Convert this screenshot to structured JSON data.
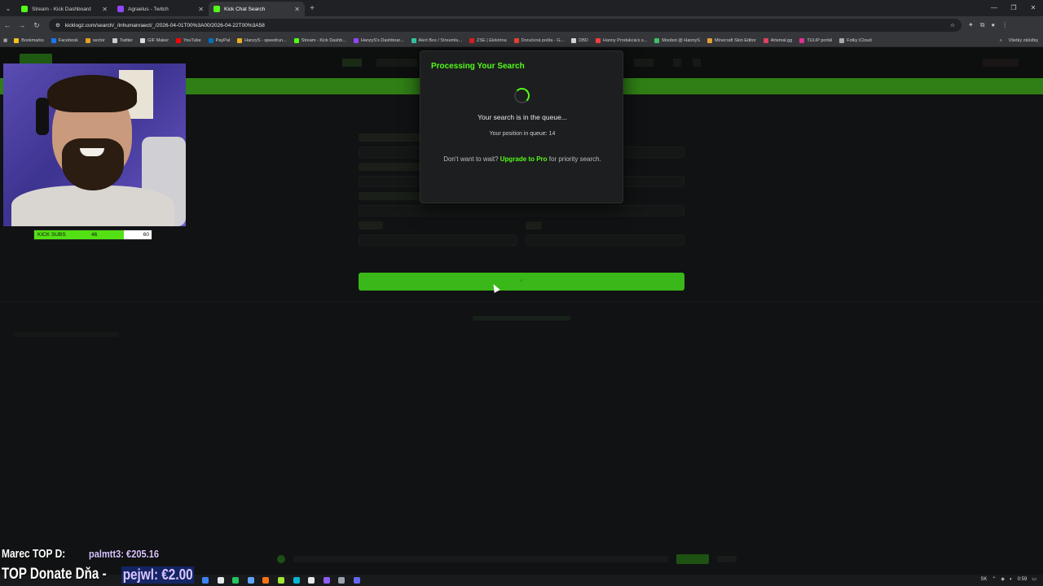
{
  "browser": {
    "tabs": [
      {
        "label": "Stream - Kick Dashboard",
        "color": "#53fc18",
        "active": false
      },
      {
        "label": "Agraelus - Twitch",
        "color": "#9146ff",
        "active": false
      },
      {
        "label": "Kick Chat Search",
        "color": "#53fc18",
        "active": true
      }
    ],
    "url": "kicklogz.com/search/_/inhumanraect/_/2026-04-01T00%3A00/2026-04-22T00%3A58",
    "bookmarks": [
      {
        "label": "Bookmarks",
        "color": "#f0c419"
      },
      {
        "label": "Facebook",
        "color": "#1877f2"
      },
      {
        "label": "sector",
        "color": "#e8a020"
      },
      {
        "label": "Twitter",
        "color": "#cccccc"
      },
      {
        "label": "GIF Maker",
        "color": "#dddddd"
      },
      {
        "label": "YouTube",
        "color": "#ff0000"
      },
      {
        "label": "PayPal",
        "color": "#0070ba"
      },
      {
        "label": "HanzyS - speedrun...",
        "color": "#e8b020"
      },
      {
        "label": "Stream - Kick Dashb...",
        "color": "#53fc18"
      },
      {
        "label": "HanzyS's Dashboar...",
        "color": "#9146ff"
      },
      {
        "label": "Alert Box / Streamla...",
        "color": "#31c3a2"
      },
      {
        "label": "ZSE | Elektrina",
        "color": "#e02020"
      },
      {
        "label": "Doručená pošta - G...",
        "color": "#ea4335"
      },
      {
        "label": "DBD",
        "color": "#dddddd"
      },
      {
        "label": "Hanny Produkcia's s...",
        "color": "#ff4040"
      },
      {
        "label": "Moobot @ HannyS",
        "color": "#40c060"
      },
      {
        "label": "Minecraft Skin Editor",
        "color": "#e0a030"
      },
      {
        "label": "Artemal.gg",
        "color": "#e04060"
      },
      {
        "label": "TULIP portál",
        "color": "#e03090"
      },
      {
        "label": "Fotky iCloud",
        "color": "#aaaaaa"
      }
    ],
    "bookmarks_other": "Všetky záložky"
  },
  "modal": {
    "title": "Processing Your Search",
    "queue_message": "Your search is in the queue...",
    "position_label": "Your position in queue:",
    "position_value": "14",
    "upsell_prefix": "Don't want to wait?",
    "upsell_link": "Upgrade to Pro",
    "upsell_suffix": "for priority search."
  },
  "overlay": {
    "subs_label": "KICK SUBS",
    "subs_current": "46",
    "subs_goal": "60",
    "subs_progress": 0.767,
    "top_d_label": "Marec TOP D:",
    "top_d_value": "palmtt3: €205.16",
    "top_donate_label": "TOP Donate Dňa -",
    "top_donate_value": "pejwl: €2.00"
  },
  "taskbar": {
    "lang": "SK",
    "time": "0:59"
  },
  "colors": {
    "kick_green": "#53fc18",
    "background": "#0e0f10"
  }
}
